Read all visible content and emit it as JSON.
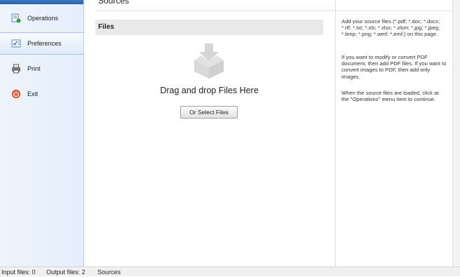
{
  "sidebar": {
    "items": [
      {
        "label": "Operations",
        "icon": "operations-icon"
      },
      {
        "label": "Preferences",
        "icon": "preferences-icon"
      },
      {
        "label": "Print",
        "icon": "printer-icon"
      },
      {
        "label": "Exit",
        "icon": "power-icon"
      }
    ],
    "selected_index": 1
  },
  "main": {
    "section_title": "Sources",
    "files_header": "Files",
    "drop_text": "Drag and drop Files Here",
    "select_button": "Or Select Files"
  },
  "help": {
    "p1": "Add your source files (*.pdf; *.doc; *.docx; *.rtf; *.txt; *.xls; *.xlsx; *.xlsm; *.jpg; *.jpeg; *.bmp; *.png; *.wmf; *.emf;) on this page.",
    "p2": "If you want to modify or convert PDF document, then add PDF files. If you want to convert images to PDF, then add only images.",
    "p3": "When the source files are loaded, click at the \"Operations\" menu item to continue."
  },
  "statusbar": {
    "input_files": "Input files: 0",
    "output_files": "Output files: 2",
    "current_page": "Sources"
  },
  "colors": {
    "accent_blue": "#2a5faa",
    "sidebar_bg": "#e8f0fb",
    "exit_orange": "#e8542a"
  }
}
